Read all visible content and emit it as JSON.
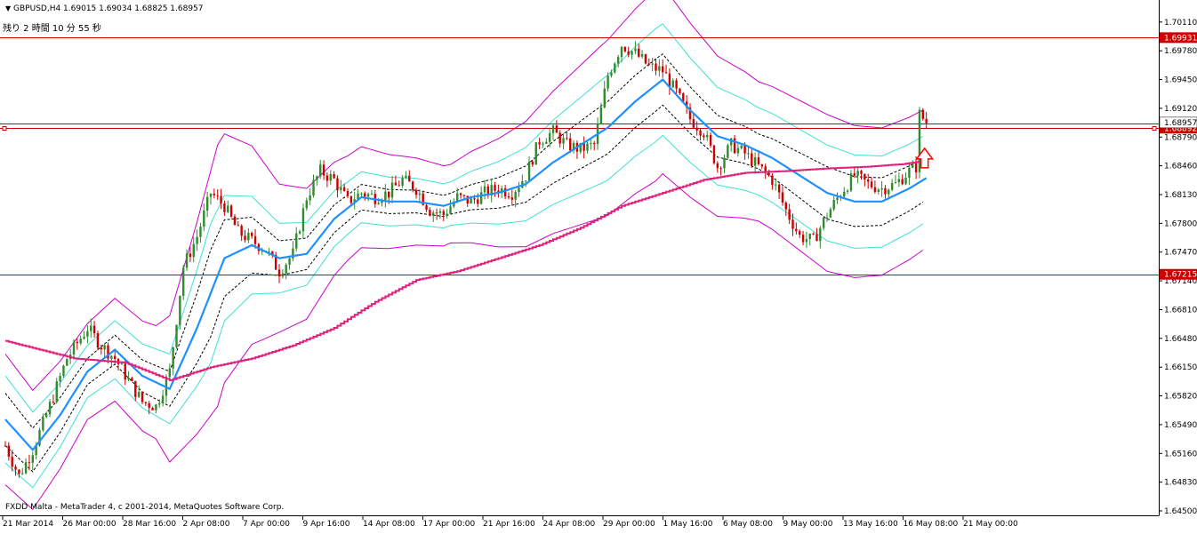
{
  "header": {
    "triangle_icon": "triangle-down-icon",
    "title": "GBPUSD,H4  1.69015 1.69034 1.68825 1.68957",
    "countdown": "残り 2 時間 10 分 55 秒"
  },
  "footer": {
    "copyright": "FXDD Malta - MetaTrader 4, c 2001-2014, MetaQuotes Software Corp."
  },
  "colors": {
    "background": "#ffffff",
    "bull_candle": "#2e8b2e",
    "bear_candle": "#cc0000",
    "sma": "#1e90ff",
    "bb_inner": "#000000",
    "bb_mid": "#40e0d0",
    "bb_outer": "#cc00cc",
    "trail": "#e0207a",
    "hline": "#cc0000",
    "arrow": "#ff0000"
  },
  "chart_data": {
    "type": "candlestick",
    "symbol": "GBPUSD",
    "timeframe": "H4",
    "ylim": [
      1.645,
      1.7021
    ],
    "y_ticks": [
      "1.70110",
      "1.69780",
      "1.69450",
      "1.69120",
      "1.68790",
      "1.68460",
      "1.68130",
      "1.67800",
      "1.67470",
      "1.67140",
      "1.66810",
      "1.66480",
      "1.66150",
      "1.65820",
      "1.65490",
      "1.65160",
      "1.64830",
      "1.64500"
    ],
    "x_labels": [
      "21 Mar 2014",
      "26 Mar 00:00",
      "28 Mar 16:00",
      "2 Apr 08:00",
      "7 Apr 00:00",
      "9 Apr 16:00",
      "14 Apr 08:00",
      "17 Apr 00:00",
      "21 Apr 16:00",
      "24 Apr 08:00",
      "29 Apr 00:00",
      "1 May 16:00",
      "6 May 08:00",
      "9 May 00:00",
      "13 May 16:00",
      "16 May 08:00",
      "21 May 00:00"
    ],
    "horizontal_lines": [
      {
        "price": 1.69931,
        "label": "1.69931"
      },
      {
        "price": 1.68892,
        "label": "1.68892",
        "style": "double"
      },
      {
        "price": 1.67215,
        "label": "1.67215"
      }
    ],
    "current_price": {
      "price": 1.68957,
      "label": "1.68957"
    },
    "close_path": [
      [
        0,
        1.6525
      ],
      [
        4,
        1.649
      ],
      [
        8,
        1.652
      ],
      [
        12,
        1.656
      ],
      [
        18,
        1.6625
      ],
      [
        24,
        1.666
      ],
      [
        28,
        1.664
      ],
      [
        32,
        1.6625
      ],
      [
        36,
        1.66
      ],
      [
        40,
        1.6575
      ],
      [
        44,
        1.657
      ],
      [
        48,
        1.661
      ],
      [
        52,
        1.673
      ],
      [
        56,
        1.6765
      ],
      [
        60,
        1.6815
      ],
      [
        64,
        1.68
      ],
      [
        68,
        1.677
      ],
      [
        72,
        1.676
      ],
      [
        76,
        1.675
      ],
      [
        80,
        1.6725
      ],
      [
        84,
        1.6745
      ],
      [
        88,
        1.681
      ],
      [
        92,
        1.684
      ],
      [
        96,
        1.683
      ],
      [
        100,
        1.6805
      ],
      [
        104,
        1.6815
      ],
      [
        108,
        1.681
      ],
      [
        112,
        1.6815
      ],
      [
        116,
        1.683
      ],
      [
        120,
        1.682
      ],
      [
        124,
        1.6795
      ],
      [
        128,
        1.679
      ],
      [
        132,
        1.681
      ],
      [
        136,
        1.6805
      ],
      [
        140,
        1.6815
      ],
      [
        144,
        1.682
      ],
      [
        148,
        1.6815
      ],
      [
        152,
        1.6835
      ],
      [
        156,
        1.6875
      ],
      [
        160,
        1.6885
      ],
      [
        164,
        1.687
      ],
      [
        168,
        1.6865
      ],
      [
        172,
        1.687
      ],
      [
        176,
        1.695
      ],
      [
        180,
        1.6985
      ],
      [
        184,
        1.6975
      ],
      [
        188,
        1.696
      ],
      [
        192,
        1.6955
      ],
      [
        196,
        1.693
      ],
      [
        200,
        1.69
      ],
      [
        204,
        1.6885
      ],
      [
        208,
        1.6845
      ],
      [
        212,
        1.687
      ],
      [
        216,
        1.686
      ],
      [
        220,
        1.6845
      ],
      [
        224,
        1.683
      ],
      [
        228,
        1.6795
      ],
      [
        232,
        1.6765
      ],
      [
        236,
        1.676
      ],
      [
        240,
        1.679
      ],
      [
        244,
        1.6815
      ],
      [
        248,
        1.6835
      ],
      [
        252,
        1.6825
      ],
      [
        256,
        1.682
      ],
      [
        260,
        1.6825
      ],
      [
        264,
        1.684
      ],
      [
        266,
        1.6845
      ],
      [
        267,
        1.6905
      ],
      [
        269,
        1.6896
      ]
    ],
    "sma_path": [
      [
        0,
        1.6555
      ],
      [
        8,
        1.652
      ],
      [
        16,
        1.656
      ],
      [
        24,
        1.661
      ],
      [
        32,
        1.6635
      ],
      [
        40,
        1.6605
      ],
      [
        48,
        1.659
      ],
      [
        56,
        1.666
      ],
      [
        64,
        1.674
      ],
      [
        72,
        1.6755
      ],
      [
        80,
        1.674
      ],
      [
        88,
        1.6745
      ],
      [
        96,
        1.6785
      ],
      [
        104,
        1.681
      ],
      [
        112,
        1.6805
      ],
      [
        120,
        1.6805
      ],
      [
        128,
        1.68
      ],
      [
        136,
        1.681
      ],
      [
        144,
        1.6815
      ],
      [
        152,
        1.6825
      ],
      [
        160,
        1.685
      ],
      [
        168,
        1.687
      ],
      [
        176,
        1.689
      ],
      [
        184,
        1.692
      ],
      [
        192,
        1.6945
      ],
      [
        200,
        1.691
      ],
      [
        208,
        1.688
      ],
      [
        216,
        1.687
      ],
      [
        224,
        1.6855
      ],
      [
        232,
        1.6835
      ],
      [
        240,
        1.6815
      ],
      [
        248,
        1.6805
      ],
      [
        256,
        1.6805
      ],
      [
        264,
        1.682
      ],
      [
        269,
        1.6832
      ]
    ],
    "bb_inner_dev": [
      [
        0,
        0.003
      ],
      [
        24,
        0.0015
      ],
      [
        48,
        0.002
      ],
      [
        60,
        0.005
      ],
      [
        80,
        0.002
      ],
      [
        100,
        0.0015
      ],
      [
        130,
        0.0012
      ],
      [
        175,
        0.003
      ],
      [
        190,
        0.003
      ],
      [
        220,
        0.002
      ],
      [
        240,
        0.003
      ],
      [
        269,
        0.0025
      ]
    ],
    "bb_mid_dev": [
      [
        0,
        0.005
      ],
      [
        24,
        0.003
      ],
      [
        48,
        0.004
      ],
      [
        60,
        0.008
      ],
      [
        80,
        0.004
      ],
      [
        100,
        0.003
      ],
      [
        130,
        0.0025
      ],
      [
        175,
        0.006
      ],
      [
        190,
        0.0065
      ],
      [
        220,
        0.005
      ],
      [
        240,
        0.0055
      ],
      [
        269,
        0.005
      ]
    ],
    "bb_outer_dev": [
      [
        0,
        0.0075
      ],
      [
        24,
        0.0055
      ],
      [
        44,
        0.0065
      ],
      [
        62,
        0.015
      ],
      [
        80,
        0.0085
      ],
      [
        100,
        0.006
      ],
      [
        130,
        0.0045
      ],
      [
        175,
        0.01
      ],
      [
        190,
        0.011
      ],
      [
        220,
        0.008
      ],
      [
        240,
        0.009
      ],
      [
        269,
        0.008
      ]
    ],
    "trail_path": [
      [
        0,
        1.6645
      ],
      [
        10,
        1.6635
      ],
      [
        20,
        1.6625
      ],
      [
        35,
        1.662
      ],
      [
        48,
        1.66
      ],
      [
        60,
        1.6615
      ],
      [
        72,
        1.6625
      ],
      [
        84,
        1.664
      ],
      [
        96,
        1.666
      ],
      [
        108,
        1.669
      ],
      [
        120,
        1.6715
      ],
      [
        132,
        1.6725
      ],
      [
        144,
        1.674
      ],
      [
        156,
        1.6755
      ],
      [
        168,
        1.6775
      ],
      [
        180,
        1.68
      ],
      [
        192,
        1.6815
      ],
      [
        204,
        1.683
      ],
      [
        216,
        1.6838
      ],
      [
        228,
        1.684
      ],
      [
        240,
        1.6843
      ],
      [
        252,
        1.6845
      ],
      [
        262,
        1.6848
      ],
      [
        269,
        1.6852
      ]
    ],
    "signal_arrow": {
      "index": 269,
      "price": 1.6862,
      "direction": "up"
    }
  }
}
